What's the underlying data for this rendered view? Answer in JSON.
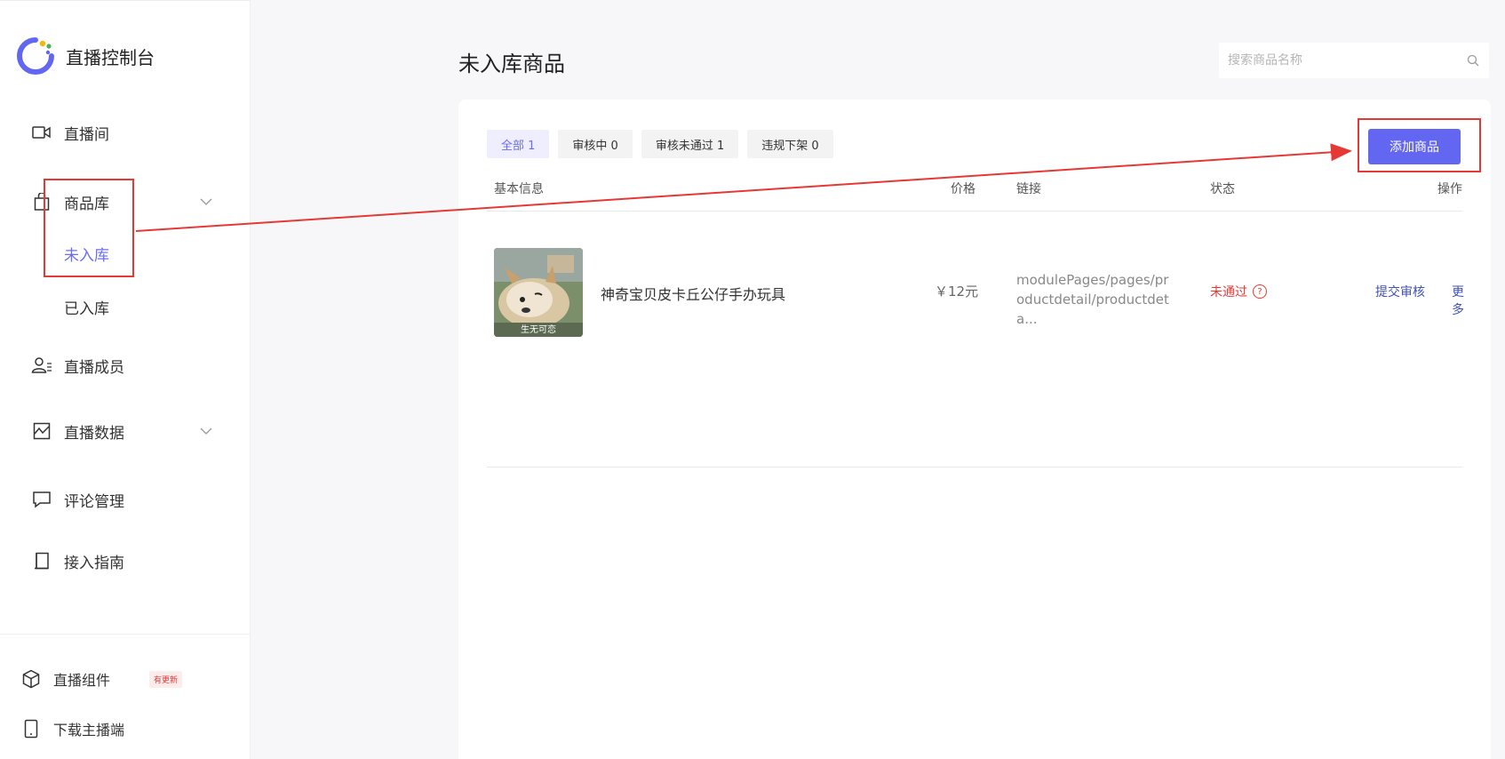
{
  "app": {
    "title": "直播控制台"
  },
  "sidebar": {
    "items": [
      {
        "label": "直播间"
      },
      {
        "label": "商品库",
        "children": [
          {
            "label": "未入库"
          },
          {
            "label": "已入库"
          }
        ]
      },
      {
        "label": "直播成员"
      },
      {
        "label": "直播数据"
      },
      {
        "label": "评论管理"
      },
      {
        "label": "接入指南"
      }
    ],
    "footer": [
      {
        "label": "直播组件",
        "badge": "有更新"
      },
      {
        "label": "下载主播端"
      }
    ]
  },
  "main": {
    "title": "未入库商品",
    "search": {
      "placeholder": "搜索商品名称",
      "value": ""
    },
    "tabs": [
      {
        "label": "全部 1"
      },
      {
        "label": "审核中 0"
      },
      {
        "label": "审核未通过 1"
      },
      {
        "label": "违规下架 0"
      }
    ],
    "add_button": "添加商品",
    "columns": {
      "info": "基本信息",
      "price": "价格",
      "link": "链接",
      "status": "状态",
      "action": "操作"
    },
    "rows": [
      {
        "image_caption": "生无可恋",
        "name": "神奇宝贝皮卡丘公仔手办玩具",
        "price": "￥12元",
        "link": "modulePages/pages/productdetail/productdeta...",
        "status": "未通过",
        "action_submit": "提交审核",
        "action_more": "更多"
      }
    ]
  },
  "colors": {
    "accent": "#6366f1",
    "error": "#e53935",
    "annotation": "#e53935"
  }
}
